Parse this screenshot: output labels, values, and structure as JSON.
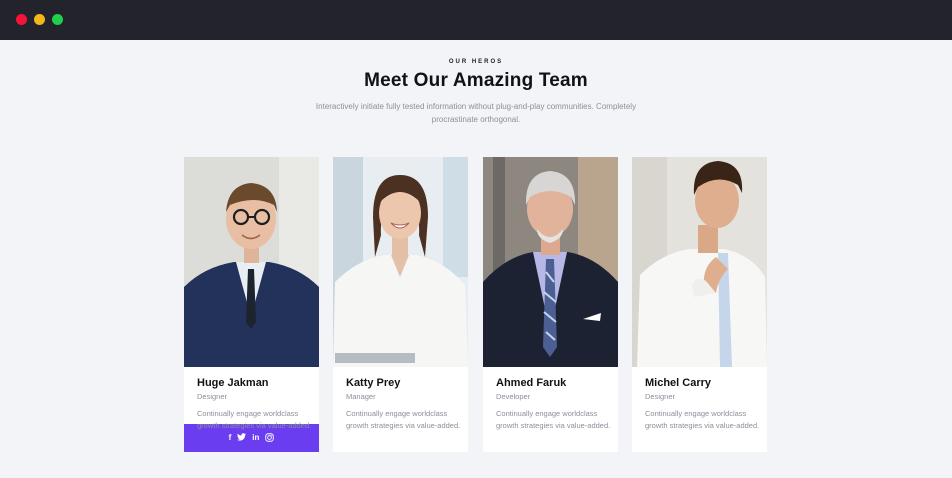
{
  "window": {
    "controls": [
      "close",
      "minimize",
      "maximize"
    ]
  },
  "section": {
    "eyebrow": "OUR HEROS",
    "title": "Meet Our Amazing Team",
    "intro": "Interactively initiate fully tested information without plug-and-play communities. Completely procrastinate orthogonal."
  },
  "colors": {
    "accent": "#6a3ef0",
    "topbar": "#23232b",
    "background": "#f3f4f7"
  },
  "social_icons": [
    "facebook-icon",
    "twitter-icon",
    "linkedin-icon",
    "instagram-icon"
  ],
  "team": [
    {
      "name": "Huge Jakman",
      "role": "Designer",
      "bio": "Continually engage worldclass growth strategies via value-added.",
      "photo": "man in navy suit with glasses"
    },
    {
      "name": "Katty Prey",
      "role": "Manager",
      "bio": "Continually engage worldclass growth strategies via value-added.",
      "photo": "woman in white blouse smiling"
    },
    {
      "name": "Ahmed Faruk",
      "role": "Developer",
      "bio": "Continually engage worldclass growth strategies via value-added.",
      "photo": "grey-haired man in dark suit"
    },
    {
      "name": "Michel Carry",
      "role": "Designer",
      "bio": "Continually engage worldclass growth strategies via value-added.",
      "photo": "man in white shirt with tie"
    }
  ]
}
